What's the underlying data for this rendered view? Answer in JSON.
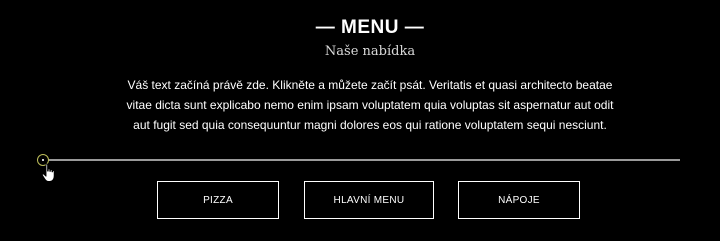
{
  "menu_section": {
    "title": "— MENU —",
    "subtitle": "Naše nabídka",
    "body": "Váš text začíná právě zde. Klikněte a můžete začít psát. Veritatis et quasi architecto beatae vitae dicta sunt explicabo nemo enim ipsam voluptatem quia voluptas sit aspernatur aut odit aut fugit sed quia consequuntur magni dolores eos qui ratione voluptatem sequi nesciunt.",
    "buttons": [
      {
        "label": "PIZZA"
      },
      {
        "label": "HLAVNÍ MENU"
      },
      {
        "label": "NÁPOJE"
      }
    ]
  },
  "colors": {
    "background": "#000000",
    "text": "#ffffff",
    "subtitle": "#d9d9d9",
    "divider": "#9a9a9a",
    "handle_accent": "#bdbd5a"
  },
  "icons": {
    "divider_handle": "plus-icon",
    "cursor": "hand-cursor-icon"
  }
}
